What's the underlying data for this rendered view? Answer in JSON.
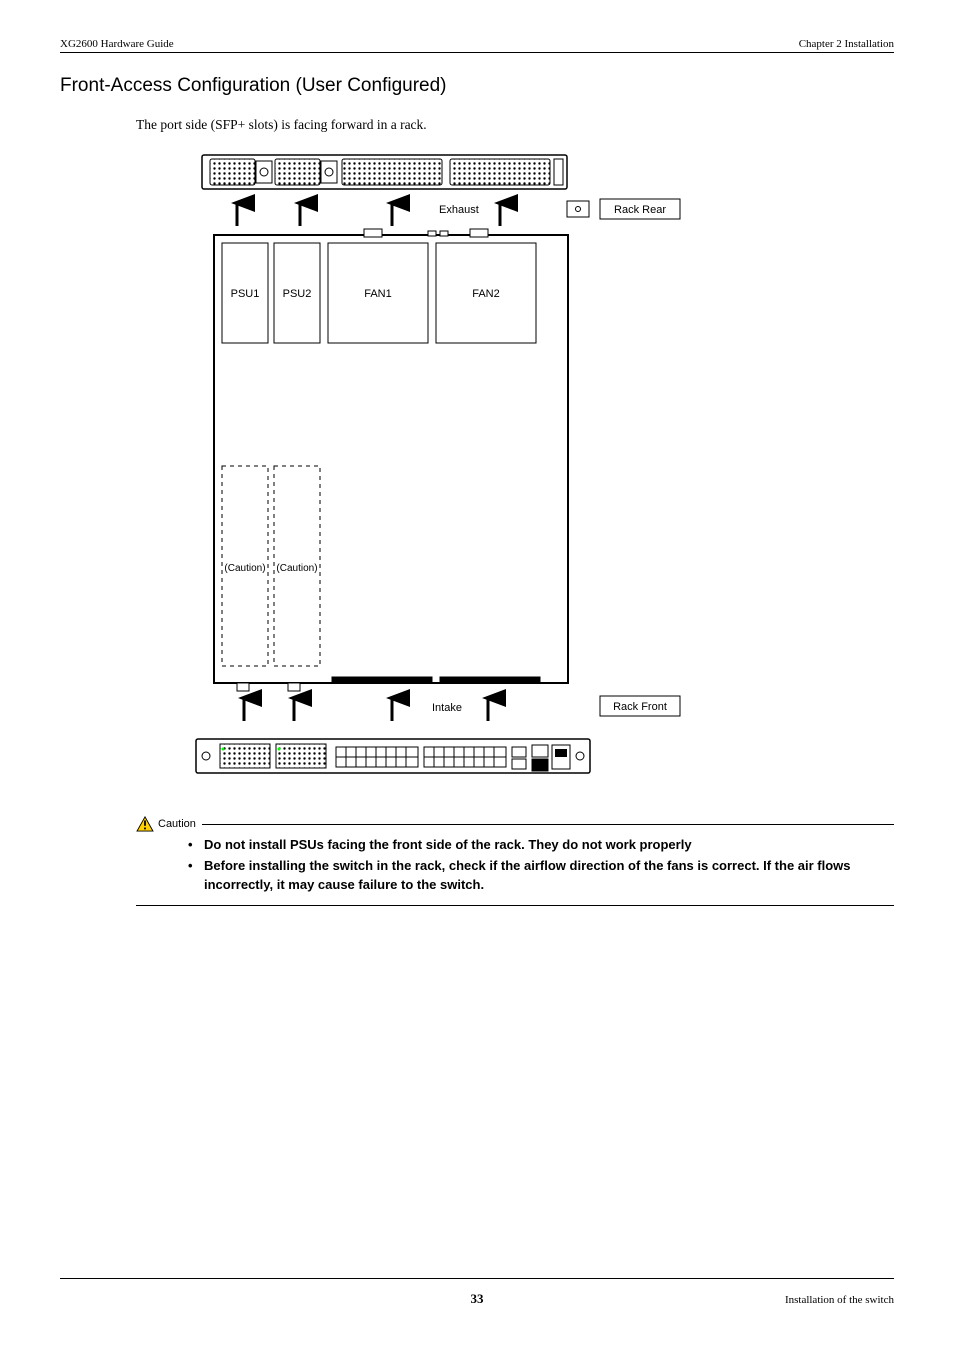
{
  "header": {
    "left": "XG2600 Hardware Guide",
    "right": "Chapter 2 Installation"
  },
  "section_heading": "Front-Access Configuration (User Configured)",
  "intro_text": "The port side (SFP+ slots) is facing forward in a rack.",
  "diagram": {
    "rack_rear": "Rack Rear",
    "rack_front": "Rack Front",
    "exhaust": "Exhaust",
    "intake": "Intake",
    "psu1": "PSU1",
    "psu2": "PSU2",
    "fan1": "FAN1",
    "fan2": "FAN2",
    "caution_left": "(Caution)",
    "caution_right": "(Caution)"
  },
  "caution": {
    "label": "Caution",
    "bullets": [
      "Do not install PSUs facing the front side of the rack. They do not work properly",
      "Before installing the switch in the rack, check if the airflow direction of the fans is correct. If the air flows incorrectly, it may cause failure to the switch."
    ]
  },
  "footer": {
    "page_number": "33",
    "right": "Installation of the switch"
  }
}
